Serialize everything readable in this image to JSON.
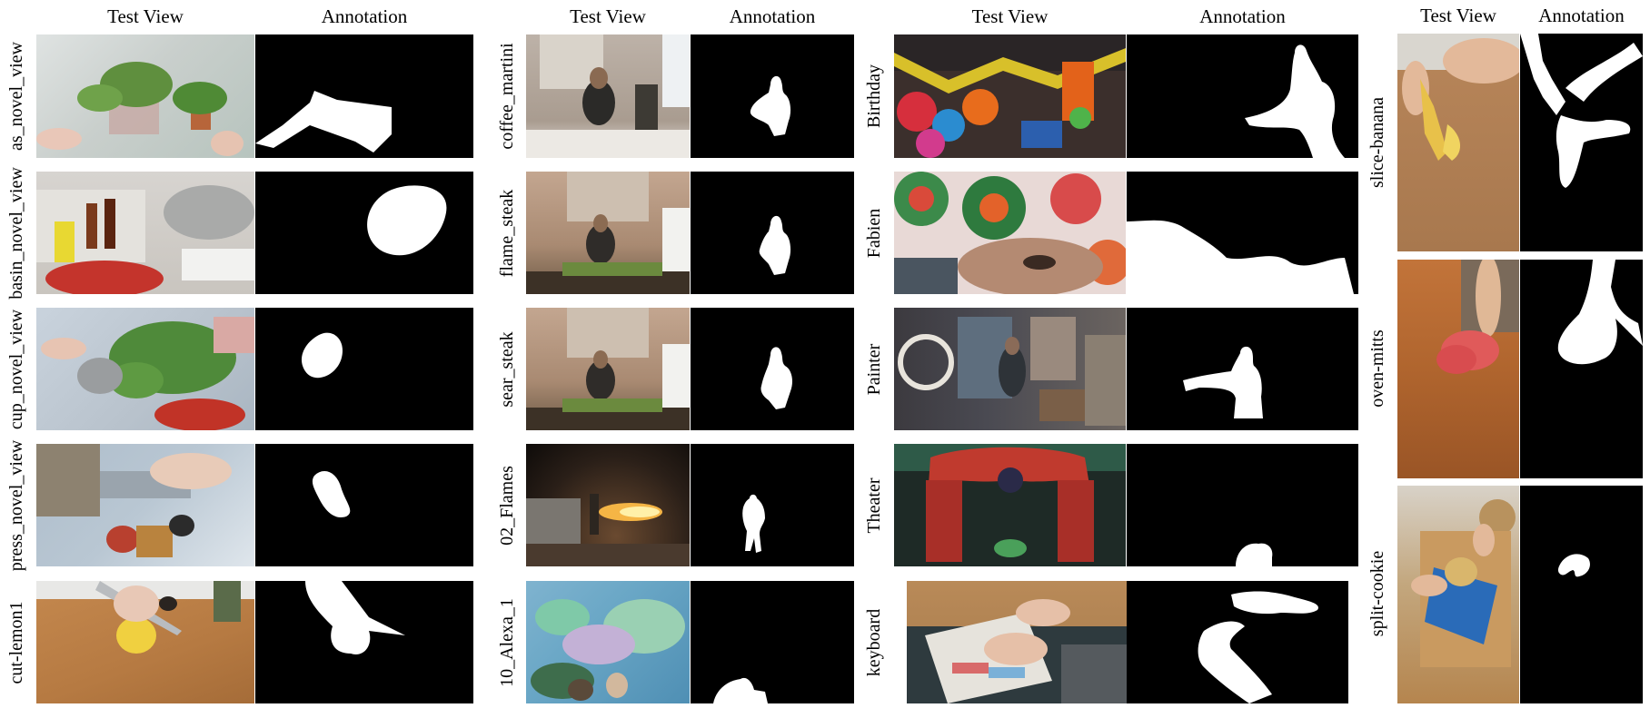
{
  "panels": [
    {
      "header_test": "Test View",
      "header_annotation": "Annotation",
      "rows": [
        {
          "label": "as_novel_view"
        },
        {
          "label": "basin_novel_view"
        },
        {
          "label": "cup_novel_view"
        },
        {
          "label": "press_novel_view"
        },
        {
          "label": "cut-lemon1"
        }
      ]
    },
    {
      "header_test": "Test View",
      "header_annotation": "Annotation",
      "rows": [
        {
          "label": "coffee_martini"
        },
        {
          "label": "flame_steak"
        },
        {
          "label": "sear_steak"
        },
        {
          "label": "02_Flames"
        },
        {
          "label": "10_Alexa_1"
        }
      ]
    },
    {
      "header_test": "Test View",
      "header_annotation": "Annotation",
      "rows": [
        {
          "label": "Birthday"
        },
        {
          "label": "Fabien"
        },
        {
          "label": "Painter"
        },
        {
          "label": "Theater"
        },
        {
          "label": "keyboard"
        }
      ]
    },
    {
      "header_test": "Test View",
      "header_annotation": "Annotation",
      "rows": [
        {
          "label": "slice-banana"
        },
        {
          "label": "oven-mitts"
        },
        {
          "label": "split-cookie"
        }
      ]
    }
  ],
  "colors": {
    "mask_background": "#000000",
    "mask_foreground": "#ffffff"
  }
}
